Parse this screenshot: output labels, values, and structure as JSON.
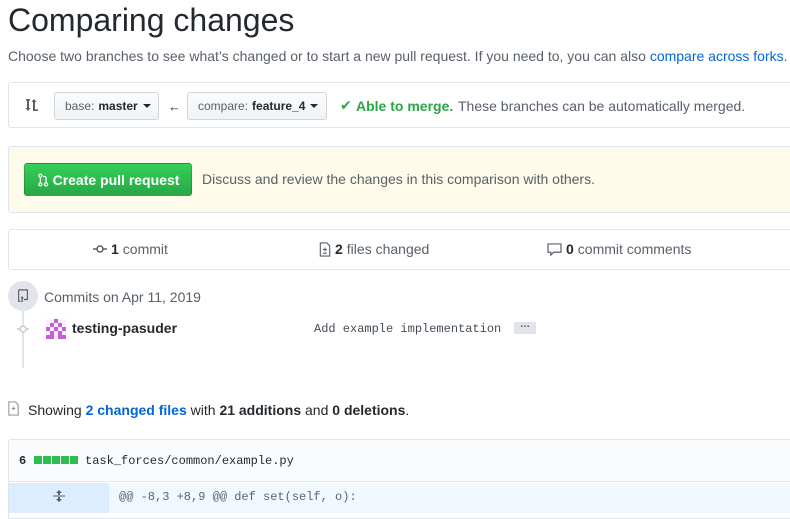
{
  "page": {
    "title": "Comparing changes",
    "subtitle_text": "Choose two branches to see what’s changed or to start a new pull request. If you need to, you can also",
    "subtitle_link": "compare across forks",
    "subtitle_end": "."
  },
  "range": {
    "base_prefix": "base:",
    "base_branch": "master",
    "compare_prefix": "compare:",
    "compare_branch": "feature_4",
    "merge_status": "Able to merge.",
    "merge_description": "These branches can be automatically merged."
  },
  "pull_request": {
    "button_label": "Create pull request",
    "description": "Discuss and review the changes in this comparison with others."
  },
  "stats": {
    "commits_count": "1",
    "commits_label": "commit",
    "files_count": "2",
    "files_label": "files changed",
    "comments_count": "0",
    "comments_label": "commit comments"
  },
  "commits": {
    "heading": "Commits on Apr 11, 2019",
    "items": [
      {
        "author": "testing-pasuder",
        "message": "Add example implementation",
        "more": "…"
      }
    ]
  },
  "summary": {
    "prefix": "Showing",
    "files_link": "2 changed files",
    "with": "with",
    "additions": "21 additions",
    "and": "and",
    "deletions": "0 deletions",
    "end": "."
  },
  "file": {
    "changes": "6",
    "additions_blocks": 5,
    "path": "task_forces/common/example.py",
    "hunk_header": "@@ -8,3 +8,9 @@ def set(self, o):"
  },
  "colors": {
    "accent_link": "#0366d6",
    "success": "#28a745",
    "notice_bg": "#fffbea",
    "hunk_bg": "#f1f8ff"
  }
}
